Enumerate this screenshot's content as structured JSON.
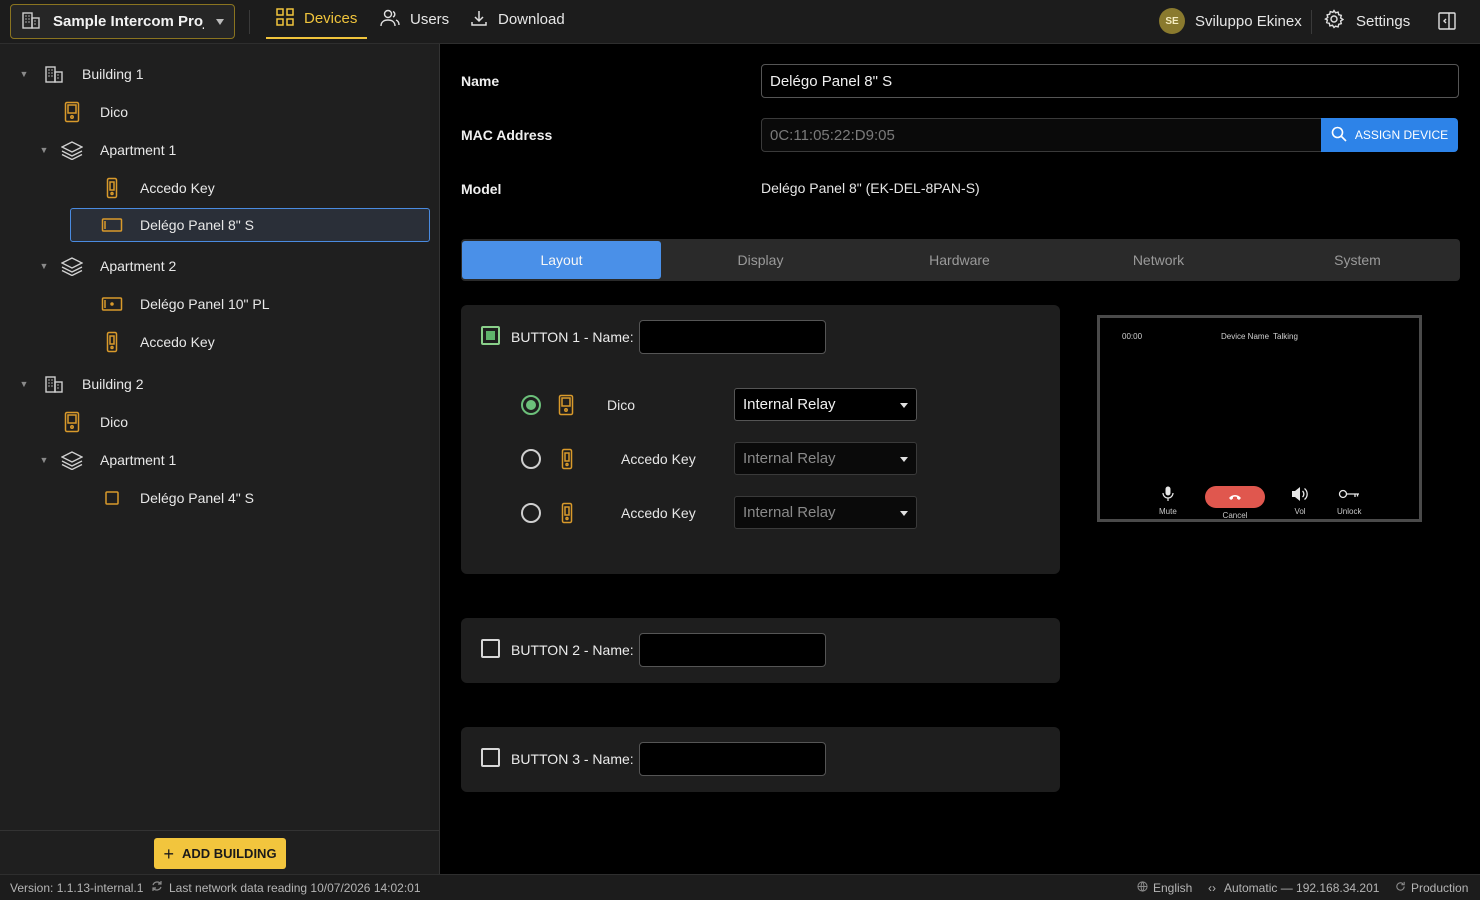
{
  "topbar": {
    "project": "Sample Intercom Proj...",
    "nav": [
      {
        "label": "Devices",
        "active": true
      },
      {
        "label": "Users",
        "active": false
      },
      {
        "label": "Download",
        "active": false
      }
    ],
    "user_initials": "SE",
    "user_name": "Sviluppo Ekinex",
    "settings_label": "Settings"
  },
  "sidebar": {
    "tree": [
      {
        "label": "Building 1",
        "icon": "building-icon",
        "expanded": true
      },
      {
        "label": "Dico",
        "icon": "dico-device-icon"
      },
      {
        "label": "Apartment 1",
        "icon": "layers-icon",
        "expanded": true
      },
      {
        "label": "Accedo Key",
        "icon": "accedo-key-icon"
      },
      {
        "label": "Delégo Panel 8\" S",
        "icon": "panel-icon",
        "selected": true
      },
      {
        "label": "Apartment 2",
        "icon": "layers-icon",
        "expanded": true
      },
      {
        "label": "Delégo Panel 10\" PL",
        "icon": "panel-icon"
      },
      {
        "label": "Accedo Key",
        "icon": "accedo-key-icon"
      },
      {
        "label": "Building 2",
        "icon": "building-icon",
        "expanded": true
      },
      {
        "label": "Dico",
        "icon": "dico-device-icon"
      },
      {
        "label": "Apartment 1",
        "icon": "layers-icon",
        "expanded": true
      },
      {
        "label": "Delégo Panel 4\" S",
        "icon": "panel-small-icon"
      }
    ],
    "add_building_label": "ADD BUILDING"
  },
  "form": {
    "name_label": "Name",
    "name_value": "Delégo Panel 8\" S",
    "mac_label": "MAC Address",
    "mac_placeholder": "0C:11:05:22:D9:05",
    "assign_label": "ASSIGN DEVICE",
    "model_label": "Model",
    "model_value": "Delégo Panel 8\" (EK-DEL-8PAN-S)"
  },
  "tabs": [
    {
      "label": "Layout",
      "active": true
    },
    {
      "label": "Display",
      "active": false
    },
    {
      "label": "Hardware",
      "active": false
    },
    {
      "label": "Network",
      "active": false
    },
    {
      "label": "System",
      "active": false
    }
  ],
  "buttons": [
    {
      "label": "BUTTON 1 - Name:",
      "checked": true,
      "devices": [
        {
          "name": "Dico",
          "icon": "dico-device-icon",
          "relay": "Internal Relay",
          "selected": true
        },
        {
          "name": "Accedo Key",
          "icon": "accedo-key-icon",
          "relay": "Internal Relay",
          "selected": false
        },
        {
          "name": "Accedo Key",
          "icon": "accedo-key-icon",
          "relay": "Internal Relay",
          "selected": false
        }
      ]
    },
    {
      "label": "BUTTON 2 - Name:",
      "checked": false
    },
    {
      "label": "BUTTON 3 - Name:",
      "checked": false
    }
  ],
  "preview": {
    "time": "00:00",
    "device_name": "Device Name",
    "status": "Talking",
    "controls": [
      "Mute",
      "Cancel",
      "Vol",
      "Unlock"
    ]
  },
  "status": {
    "version": "Version: 1.1.13-internal.1",
    "last_reading": "Last network data reading 10/07/2026 14:02:01",
    "language": "English",
    "network": "Automatic — 192.168.34.201",
    "environment": "Production"
  },
  "colors": {
    "accent_yellow": "#f0c43c",
    "accent_blue": "#4a90e8",
    "assign_blue": "#2d83e8",
    "active_green": "#6cc07a",
    "cancel_red": "#e0574e",
    "icon_orange": "#d99a2b"
  }
}
